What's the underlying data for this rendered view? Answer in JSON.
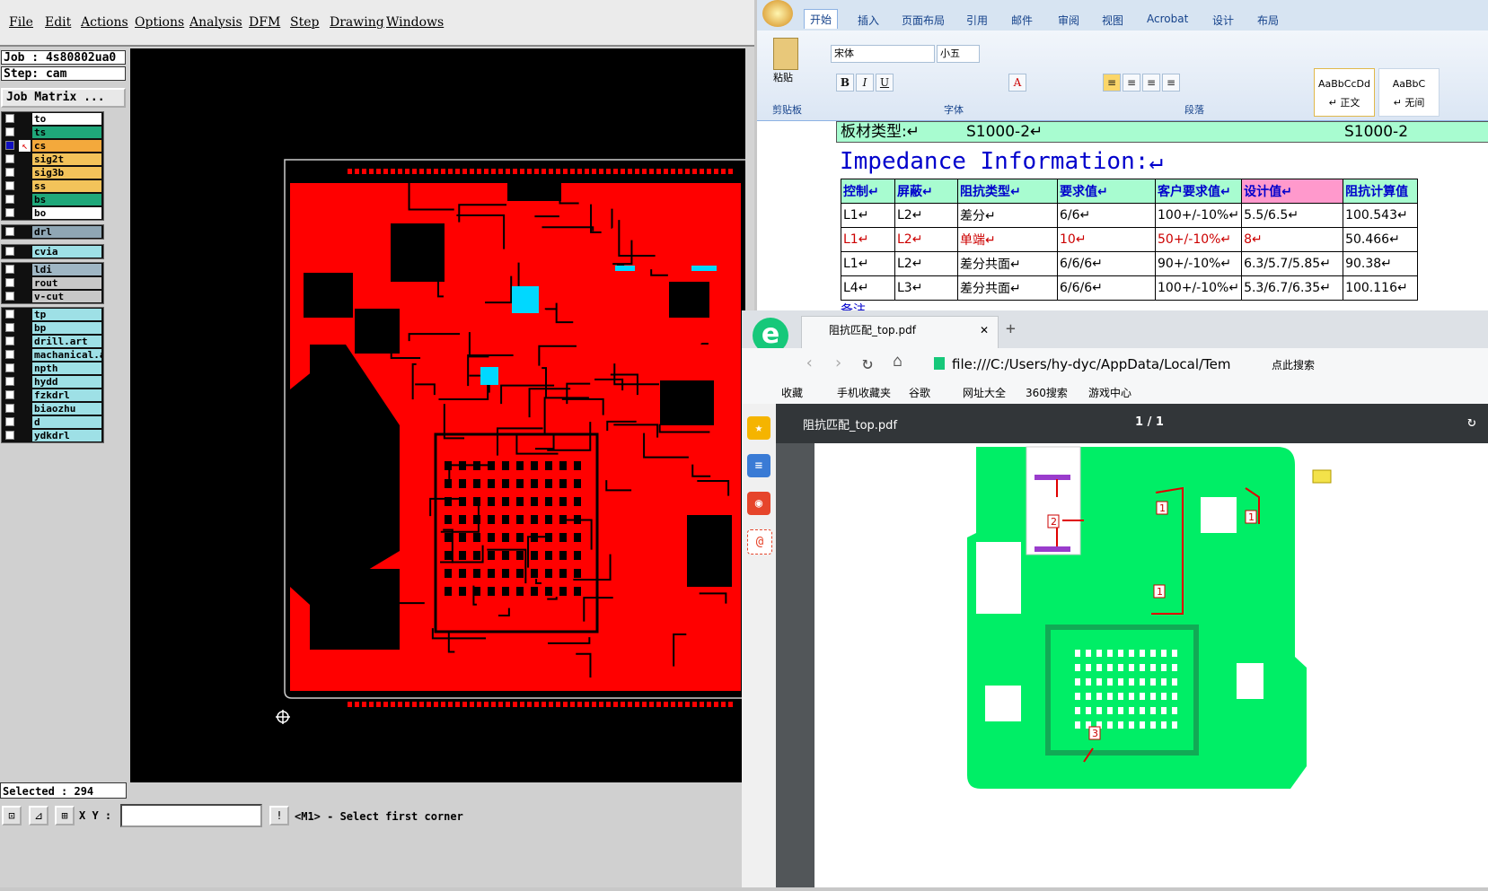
{
  "cam": {
    "menu": [
      "File",
      "Edit",
      "Actions",
      "Options",
      "Analysis",
      "DFM",
      "Step",
      "Drawing",
      "Windows"
    ],
    "job_label": "Job : 4s80802ua0",
    "step_label": "Step: cam",
    "job_matrix_label": "Job Matrix ...",
    "layer_groups": [
      [
        {
          "name": "to",
          "color": "#ffffff",
          "checked": false
        },
        {
          "name": "ts",
          "color": "#1fa87a",
          "checked": false
        },
        {
          "name": "cs",
          "color": "#f3a93c",
          "checked": true
        },
        {
          "name": "sig2t",
          "color": "#f3c35a",
          "checked": false
        },
        {
          "name": "sig3b",
          "color": "#f3c35a",
          "checked": false
        },
        {
          "name": "ss",
          "color": "#f3c35a",
          "checked": false
        },
        {
          "name": "bs",
          "color": "#1fa87a",
          "checked": false
        },
        {
          "name": "bo",
          "color": "#ffffff",
          "checked": false
        }
      ],
      [
        {
          "name": "drl",
          "color": "#8fa6b4",
          "checked": false
        }
      ],
      [
        {
          "name": "cvia",
          "color": "#9ee0e6",
          "checked": false
        }
      ],
      [
        {
          "name": "ldi",
          "color": "#9fb6c4",
          "checked": false
        },
        {
          "name": "rout",
          "color": "#c8c8c8",
          "checked": false
        },
        {
          "name": "v-cut",
          "color": "#c8c8c8",
          "checked": false
        }
      ],
      [
        {
          "name": "tp",
          "color": "#9ee0e6",
          "checked": false
        },
        {
          "name": "bp",
          "color": "#9ee0e6",
          "checked": false
        },
        {
          "name": "drill.art",
          "color": "#9ee0e6",
          "checked": false
        },
        {
          "name": "machanical.a",
          "color": "#9ee0e6",
          "checked": false
        },
        {
          "name": "npth",
          "color": "#9ee0e6",
          "checked": false
        },
        {
          "name": "hydd",
          "color": "#9ee0e6",
          "checked": false
        },
        {
          "name": "fzkdrl",
          "color": "#9ee0e6",
          "checked": false
        },
        {
          "name": "biaozhu",
          "color": "#9ee0e6",
          "checked": false
        },
        {
          "name": "d",
          "color": "#9ee0e6",
          "checked": false
        },
        {
          "name": "ydkdrl",
          "color": "#9ee0e6",
          "checked": false
        }
      ]
    ],
    "selected_label": "Selected : 294",
    "xy_label": "X Y :",
    "status_message": "<M1> - Select first corner",
    "board_color": "#ff0000"
  },
  "word": {
    "tabs": [
      "开始",
      "插入",
      "页面布局",
      "引用",
      "邮件",
      "审阅",
      "视图",
      "Acrobat",
      "设计",
      "布局"
    ],
    "clipboard": {
      "paste": "粘贴",
      "group": "剪贴板"
    },
    "font": {
      "name": "宋体",
      "size": "小五",
      "group": "字体"
    },
    "paragraph_group": "段落",
    "styles": [
      {
        "sample": "AaBbCcDd",
        "name": "↵ 正文"
      },
      {
        "sample": "AaBbC",
        "name": "↵ 无间"
      }
    ],
    "board_type_label": "板材类型:↵",
    "board_type_value": "S1000-2↵",
    "board_type_value2": "S1000-2",
    "doc_title": "Impedance Information:↵",
    "table_headers": [
      "控制↵",
      "屏蔽↵",
      "阻抗类型↵",
      "要求值↵",
      "客户要求值↵",
      "设计值↵",
      "阻抗计算值"
    ],
    "table_rows": [
      [
        "L1↵",
        "L2↵",
        "差分↵",
        "6/6↵",
        "100+/-10%↵",
        "5.5/6.5↵",
        "100.543↵"
      ],
      [
        "L1↵",
        "L2↵",
        "单端↵",
        "10↵",
        "50+/-10%↵",
        "8↵",
        "50.466↵"
      ],
      [
        "L1↵",
        "L2↵",
        "差分共面↵",
        "6/6/6↵",
        "90+/-10%↵",
        "6.3/5.7/5.85↵",
        "90.38↵"
      ],
      [
        "L4↵",
        "L3↵",
        "差分共面↵",
        "6/6/6↵",
        "100+/-10%↵",
        "5.3/6.7/6.35↵",
        "100.116↵"
      ]
    ],
    "note_fragment": "备注"
  },
  "browser": {
    "tab_title": "阻抗匹配_top.pdf",
    "url": "file:///C:/Users/hy-dyc/AppData/Local/Tem",
    "search_hint": "点此搜索",
    "bookmarks": [
      "收藏",
      "手机收藏夹",
      "谷歌",
      "网址大全",
      "360搜索",
      "游戏中心"
    ],
    "pdf_name": "阻抗匹配_top.pdf",
    "pdf_page": "1 / 1",
    "board_color": "#00ee66",
    "markers": [
      "1",
      "1",
      "1",
      "2",
      "3"
    ]
  }
}
